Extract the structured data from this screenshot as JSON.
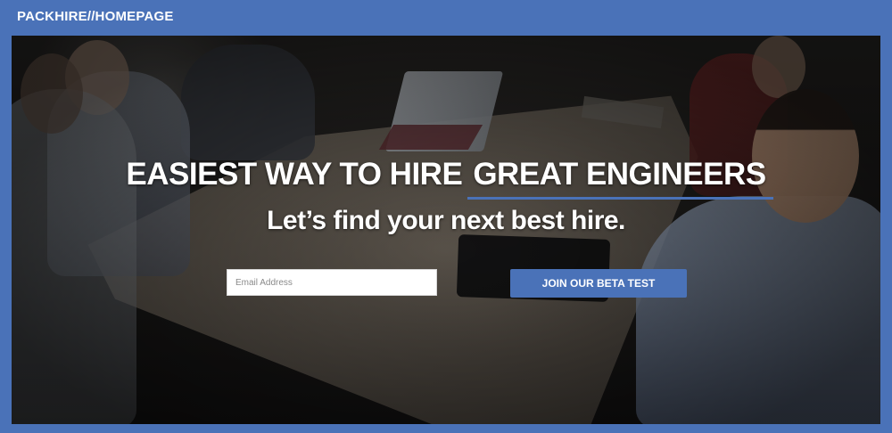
{
  "header": {
    "brand": "PACKHIRE//HOMEPAGE"
  },
  "hero": {
    "headline_lead": "EASIEST WAY TO HIRE",
    "headline_emphasis": "GREAT ENGINEERS",
    "subheadline": "Let’s find your next best hire.",
    "email_placeholder": "Email Address",
    "email_value": "",
    "cta_label": "JOIN OUR BETA TEST"
  },
  "colors": {
    "brand_blue": "#4a72b8",
    "text_white": "#ffffff"
  }
}
